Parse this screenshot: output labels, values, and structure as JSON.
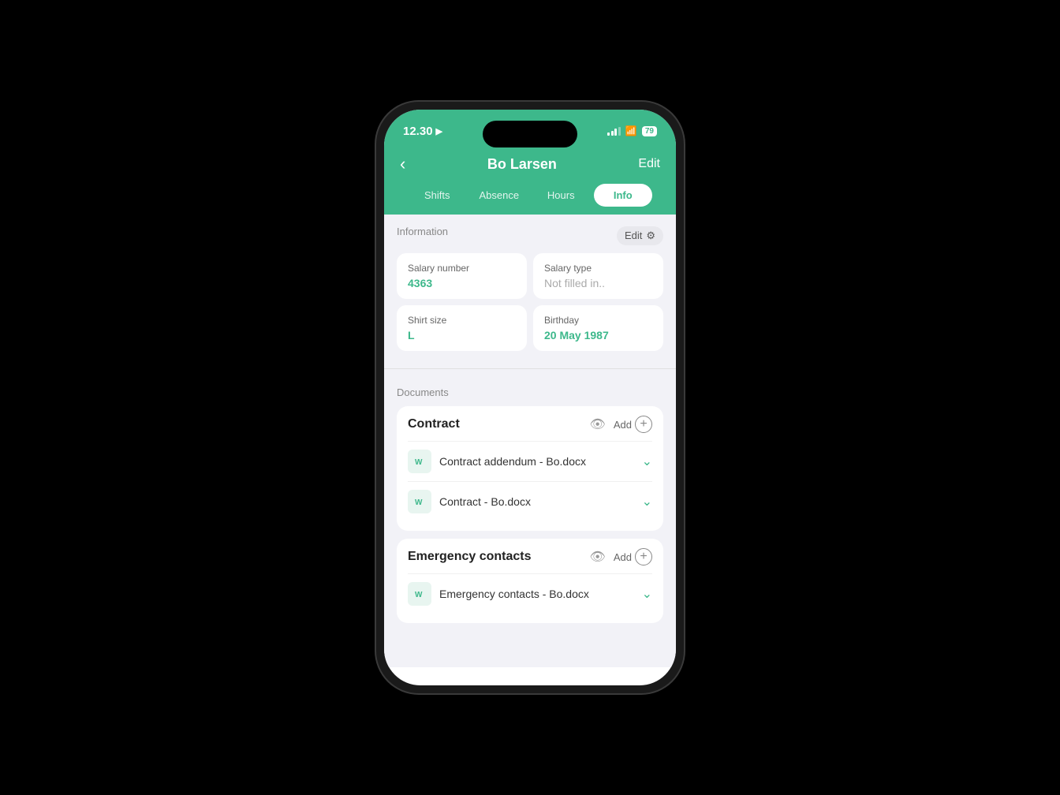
{
  "status": {
    "time": "12.30",
    "battery": "79"
  },
  "header": {
    "title": "Bo Larsen",
    "edit": "Edit",
    "back": "‹"
  },
  "tabs": [
    {
      "label": "Shifts",
      "active": false
    },
    {
      "label": "Absence",
      "active": false
    },
    {
      "label": "Hours",
      "active": false
    },
    {
      "label": "Info",
      "active": true
    }
  ],
  "information": {
    "section_label": "Information",
    "edit_label": "Edit",
    "fields": [
      {
        "label": "Salary number",
        "value": "4363",
        "muted": false
      },
      {
        "label": "Salary type",
        "value": "Not filled in..",
        "muted": true
      },
      {
        "label": "Shirt size",
        "value": "L",
        "muted": false
      },
      {
        "label": "Birthday",
        "value": "20 May 1987",
        "muted": false
      }
    ]
  },
  "documents": {
    "section_label": "Documents",
    "groups": [
      {
        "title": "Contract",
        "view_label": "",
        "add_label": "Add",
        "items": [
          {
            "name": "Contract addendum - Bo.docx"
          },
          {
            "name": "Contract - Bo.docx"
          }
        ]
      },
      {
        "title": "Emergency contacts",
        "view_label": "",
        "add_label": "Add",
        "items": [
          {
            "name": "Emergency contacts - Bo.docx"
          }
        ]
      }
    ]
  }
}
